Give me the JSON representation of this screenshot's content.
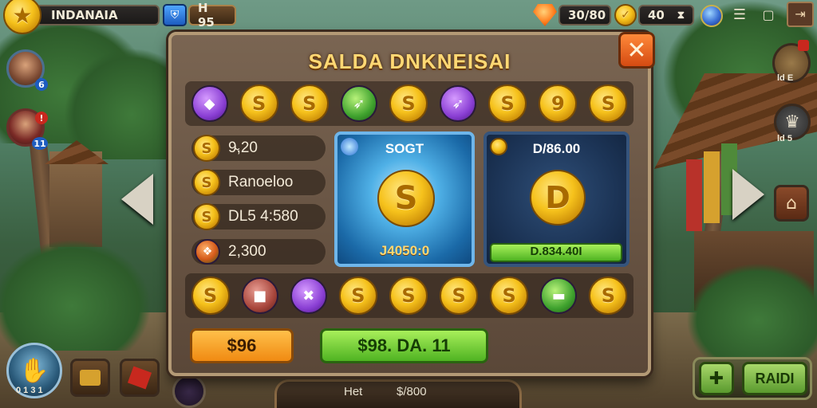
{
  "hud": {
    "player_name": "INDANAIA",
    "level_value": "H 95",
    "gems_value": "30/80",
    "coins_value": "40",
    "coins_suffix": "⧗"
  },
  "dialog": {
    "title": "SALDA DNKNEISAI",
    "close_label": "✕",
    "top_row_items": [
      {
        "kind": "gem-purple",
        "glyph": "◆"
      },
      {
        "kind": "coin",
        "glyph": "S"
      },
      {
        "kind": "coin",
        "glyph": "S"
      },
      {
        "kind": "gem-green",
        "glyph": "➶"
      },
      {
        "kind": "coin",
        "glyph": "S"
      },
      {
        "kind": "gem-purple",
        "glyph": "➶"
      },
      {
        "kind": "coin",
        "glyph": "S"
      },
      {
        "kind": "coin",
        "glyph": "9"
      },
      {
        "kind": "coin",
        "glyph": "S"
      }
    ],
    "stats": [
      {
        "glyph": "S",
        "text": "9̴,20"
      },
      {
        "glyph": "S",
        "text": "Ranoeloo"
      },
      {
        "glyph": "S",
        "text": "DL5 4:580"
      },
      {
        "glyph": "❖",
        "text": "2,300"
      }
    ],
    "card_featured": {
      "label": "SOGT",
      "coin_glyph": "S",
      "value": "J4050:0"
    },
    "card_secondary": {
      "label": "D/86.00",
      "coin_glyph": "D",
      "value": "D.834.40I"
    },
    "bottom_row_items": [
      {
        "kind": "coin",
        "glyph": "S"
      },
      {
        "kind": "gem-red",
        "glyph": "■"
      },
      {
        "kind": "gem-purple",
        "glyph": "✖"
      },
      {
        "kind": "coin",
        "glyph": "S"
      },
      {
        "kind": "coin",
        "glyph": "S"
      },
      {
        "kind": "coin",
        "glyph": "S"
      },
      {
        "kind": "coin",
        "glyph": "S"
      },
      {
        "kind": "gem-green",
        "glyph": "▬"
      },
      {
        "kind": "coin",
        "glyph": "S"
      }
    ],
    "btn_price_label": "$96",
    "btn_buy_label": "$98. DA. 11"
  },
  "footer": {
    "tab_label": "Het",
    "tab_value": "$/800"
  },
  "left_side": {
    "avatar1_badge": "6",
    "avatar2_badge": "11",
    "skill_value": "0 1 3 1"
  },
  "right_side": {
    "top_label": "ld E",
    "mid_label": "ld 5",
    "action_label": "RAIDI"
  },
  "colors": {
    "accent_gold": "#ffd874",
    "panel_bg": "#5a4738",
    "buy_green": "#4fb322",
    "price_orange": "#f08a12",
    "close_orange": "#d44a12"
  },
  "icons": {
    "player_icon": "gold-coin-icon",
    "level_icon": "shield-icon",
    "gems_icon": "heart-gem-icon",
    "coins_icon": "gold-coin-icon",
    "profile_icon": "globe-icon",
    "menu_icon": "menu-icon",
    "window_icon": "window-icon",
    "exit_icon": "exit-icon"
  }
}
